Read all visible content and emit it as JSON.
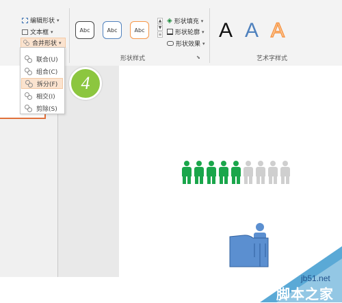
{
  "ribbon": {
    "shape_tools": {
      "edit_shape": "编辑形状",
      "text_box": "文本框",
      "merge_shapes": "合并形状"
    },
    "shape_styles": {
      "swatch_text": "Abc",
      "swatches": [
        {
          "border": "#444444"
        },
        {
          "border": "#4f81bd"
        },
        {
          "border": "#f79646"
        }
      ],
      "fill_label": "形状填充",
      "outline_label": "形状轮廓",
      "effects_label": "形状效果",
      "group_label": "形状样式"
    },
    "wordart": {
      "letters": [
        {
          "text": "A",
          "color": "#111111"
        },
        {
          "text": "A",
          "color": "#4f81bd"
        },
        {
          "text": "A",
          "color": "#f79646"
        }
      ],
      "group_label": "艺术字样式"
    }
  },
  "merge_menu": {
    "items": [
      {
        "label": "联合(U)",
        "highlighted": false
      },
      {
        "label": "组合(C)",
        "highlighted": false
      },
      {
        "label": "拆分(F)",
        "highlighted": true
      },
      {
        "label": "相交(I)",
        "highlighted": false
      },
      {
        "label": "剪除(S)",
        "highlighted": false
      }
    ]
  },
  "step_badge": {
    "text": "4",
    "color": "#8cc63f"
  },
  "slide": {
    "people": {
      "green_count": 5,
      "gray_count": 4,
      "green": "#1aa64b",
      "gray": "#cfcfcf"
    },
    "blue_shape_color": "#5b8fd0"
  },
  "watermark": {
    "site": "jb51.net",
    "name": "脚本之家"
  }
}
